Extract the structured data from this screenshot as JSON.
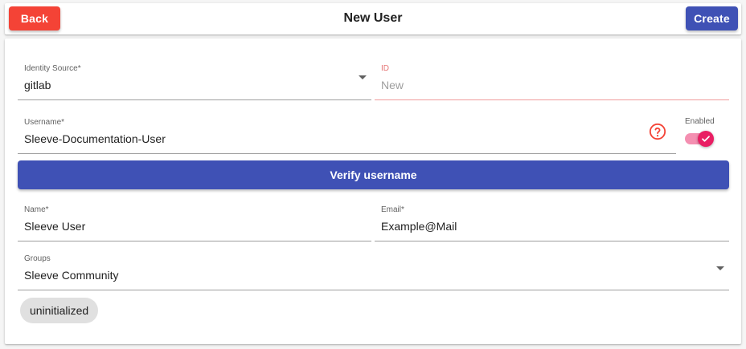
{
  "header": {
    "back_label": "Back",
    "title": "New User",
    "create_label": "Create"
  },
  "form": {
    "identity_source": {
      "label": "Identity Source*",
      "value": "gitlab"
    },
    "id": {
      "label": "ID",
      "placeholder": "New"
    },
    "username": {
      "label": "Username*",
      "value": "Sleeve-Documentation-User"
    },
    "enabled": {
      "label": "Enabled",
      "checked": true
    },
    "verify_label": "Verify username",
    "name": {
      "label": "Name*",
      "value": "Sleeve User"
    },
    "email": {
      "label": "Email*",
      "value": "Example@Mail"
    },
    "groups": {
      "label": "Groups",
      "value": "Sleeve Community"
    },
    "status_chip": "uninitialized"
  },
  "colors": {
    "danger": "#f44336",
    "primary": "#3f51b5",
    "accent": "#e91e63",
    "help": "#f44336"
  },
  "icons": {
    "help": "help-circle-icon",
    "dropdown": "chevron-down-icon",
    "check": "check-icon"
  }
}
